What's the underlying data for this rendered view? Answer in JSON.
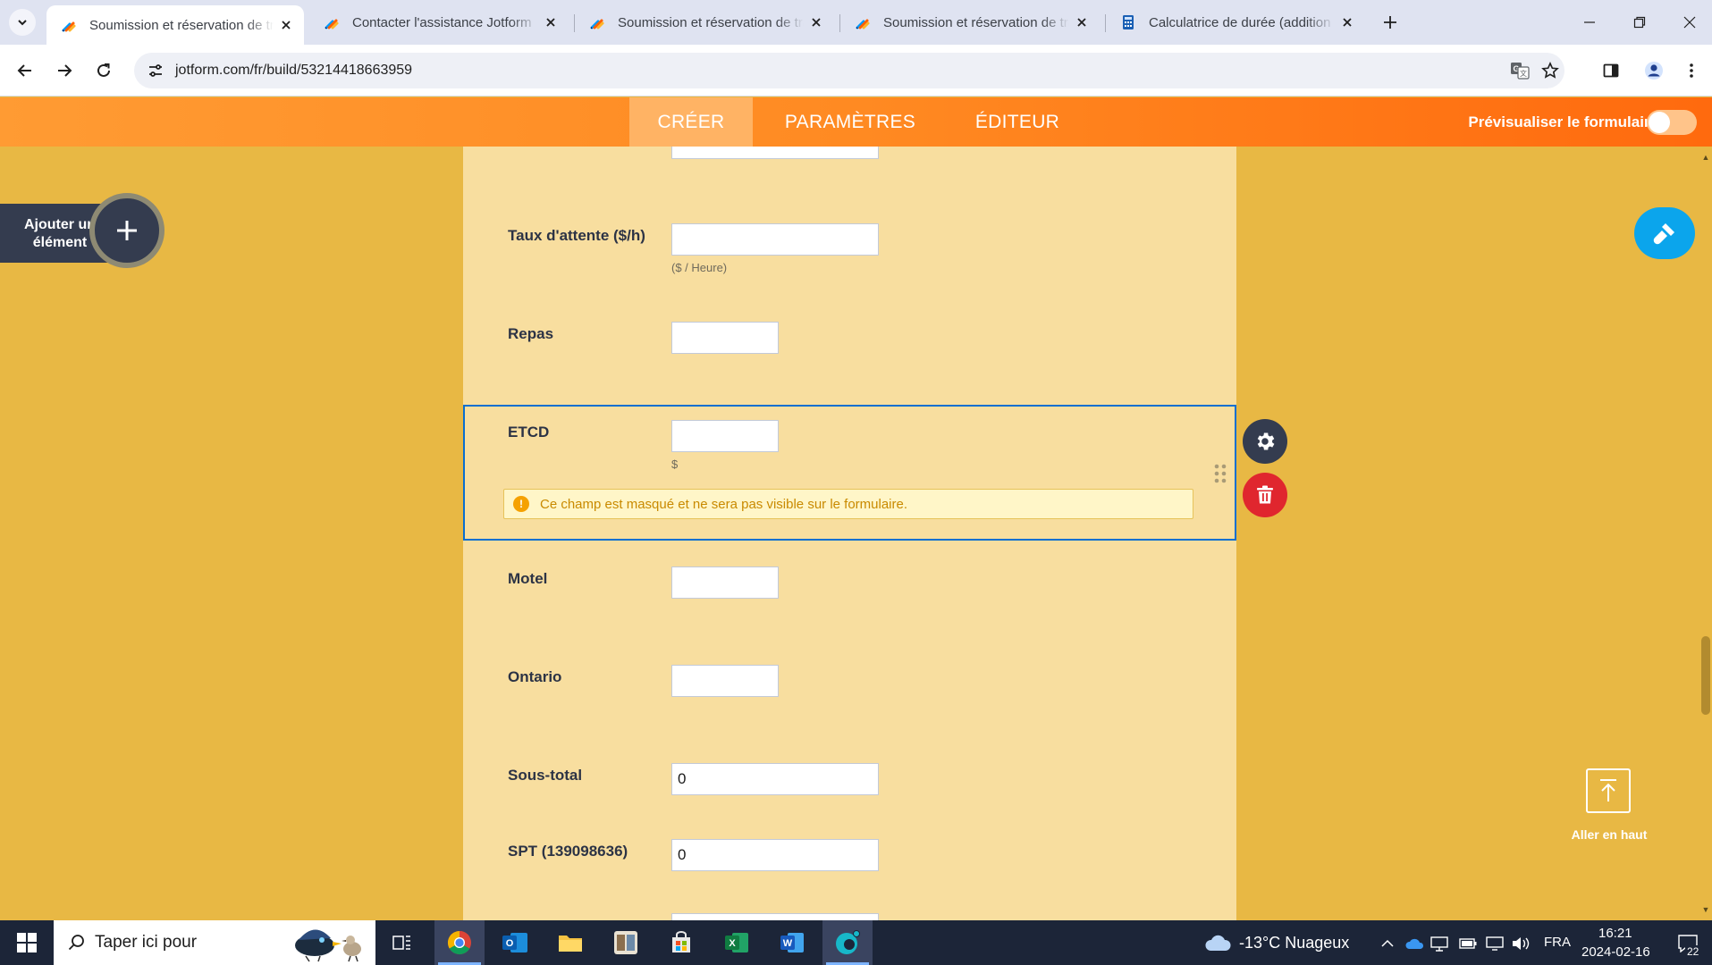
{
  "browser": {
    "tabs": [
      {
        "title": "Soumission et réservation de tra",
        "active": true
      },
      {
        "title": "Contacter l'assistance Jotform",
        "active": false
      },
      {
        "title": "Soumission et réservation de tra",
        "active": false
      },
      {
        "title": "Soumission et réservation de tra",
        "active": false
      },
      {
        "title": "Calculatrice de durée (addition",
        "active": false
      }
    ],
    "url": "jotform.com/fr/build/53214418663959"
  },
  "jotform": {
    "nav": {
      "create": "CRÉER",
      "settings": "PARAMÈTRES",
      "publish": "ÉDITEUR"
    },
    "preview_label": "Prévisualiser le formulaire",
    "add_element_label": "Ajouter un élément",
    "go_top_label": "Aller en haut"
  },
  "form": {
    "fields": [
      {
        "label": "Taux d'attente ($/h)",
        "value": "",
        "sublabel": "($ / Heure)"
      },
      {
        "label": "Repas",
        "value": ""
      },
      {
        "label": "ETCD",
        "value": "",
        "sublabel": "$",
        "hidden_notice": "Ce champ est masqué et ne sera pas visible sur le formulaire."
      },
      {
        "label": "Motel",
        "value": ""
      },
      {
        "label": "Ontario",
        "value": ""
      },
      {
        "label": "Sous-total",
        "value": "0"
      },
      {
        "label": "SPT (139098636)",
        "value": "0"
      }
    ]
  },
  "taskbar": {
    "search_placeholder": "Taper ici pour",
    "weather": "-13°C  Nuageux",
    "language": "FRA",
    "time": "16:21",
    "date": "2024-02-16",
    "notification_count": "22"
  },
  "colors": {
    "jotform_orange": "#ff8a22",
    "workspace": "#e8b844",
    "form_background": "#f8de9f",
    "selected_border": "#0a6fd0",
    "trash_red": "#e0262e",
    "designer_blue": "#0ba5ec"
  }
}
